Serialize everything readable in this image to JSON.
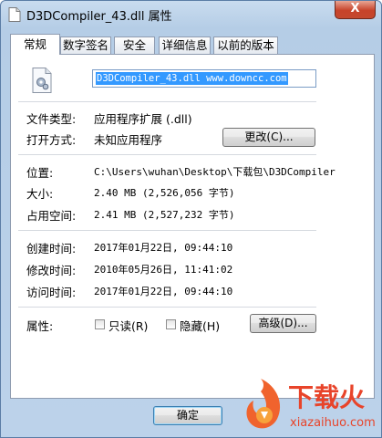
{
  "window": {
    "title": "D3DCompiler_43.dll 属性",
    "close_label": "X"
  },
  "tabs": [
    "常规",
    "数字签名",
    "安全",
    "详细信息",
    "以前的版本"
  ],
  "file_name": "D3DCompiler_43.dll  www.downcc.com",
  "fields": {
    "type_label": "文件类型:",
    "type_value": "应用程序扩展 (.dll)",
    "opens_label": "打开方式:",
    "opens_value": "未知应用程序",
    "change_button": "更改(C)...",
    "location_label": "位置:",
    "location_value": "C:\\Users\\wuhan\\Desktop\\下载包\\D3DCompiler",
    "size_label": "大小:",
    "size_value": "2.40 MB (2,526,056 字节)",
    "disk_label": "占用空间:",
    "disk_value": "2.41 MB (2,527,232 字节)",
    "created_label": "创建时间:",
    "created_value": "2017年01月22日, 09:44:10",
    "modified_label": "修改时间:",
    "modified_value": "2010年05月26日, 11:41:02",
    "accessed_label": "访问时间:",
    "accessed_value": "2017年01月22日, 09:44:10",
    "attr_label": "属性:",
    "readonly_label": "只读(R)",
    "readonly_checked": false,
    "hidden_label": "隐藏(H)",
    "hidden_checked": false,
    "advanced_button": "高级(D)..."
  },
  "buttons": {
    "ok": "确定"
  },
  "watermark": {
    "brand": "下载火",
    "domain": "xiazaihuo.com"
  },
  "icons": {
    "file": "dll-file-icon",
    "title": "document-icon"
  }
}
